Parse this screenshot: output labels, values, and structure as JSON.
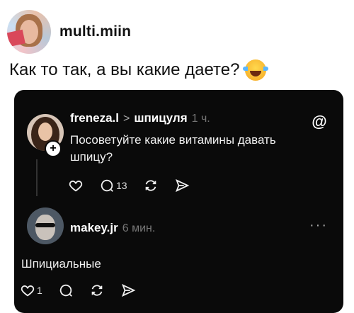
{
  "post": {
    "username": "multi.miin",
    "text": "Как то так, а вы какие даете?",
    "emoji": "laughing-tears"
  },
  "card": {
    "logo": "@",
    "first_reply": {
      "username": "freneza.l",
      "separator": ">",
      "reply_to": "шпицуля",
      "time": "1 ч.",
      "text": "Посоветуйте какие витамины давать шпицу?",
      "actions": {
        "reply_count": "13"
      }
    },
    "second_reply": {
      "username": "makey.jr",
      "time": "6 мин.",
      "text": "Шпициальные",
      "more": "···",
      "actions": {
        "like_count": "1"
      }
    }
  }
}
